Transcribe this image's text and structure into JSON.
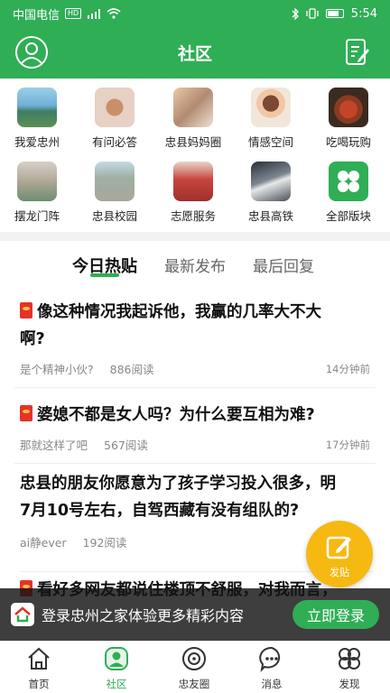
{
  "status_bar": {
    "carrier": "中国电信",
    "hd": "HD",
    "signal": "4G",
    "time": "5:54"
  },
  "header": {
    "title": "社区",
    "left_icon": "avatar-icon",
    "right_icon": "edit-note-icon"
  },
  "boards": [
    {
      "label": "我爱忠州",
      "thumb": "lake"
    },
    {
      "label": "有问必答",
      "thumb": "hands"
    },
    {
      "label": "忠县妈妈圈",
      "thumb": "moms"
    },
    {
      "label": "情感空间",
      "thumb": "girl"
    },
    {
      "label": "吃喝玩购",
      "thumb": "food"
    },
    {
      "label": "摆龙门阵",
      "thumb": "gate"
    },
    {
      "label": "忠县校园",
      "thumb": "school"
    },
    {
      "label": "志愿服务",
      "thumb": "volunteer"
    },
    {
      "label": "忠县高铁",
      "thumb": "train"
    },
    {
      "label": "全部版块",
      "thumb": "all"
    }
  ],
  "tabs": [
    {
      "label": "今日热贴",
      "active": true
    },
    {
      "label": "最新发布",
      "active": false
    },
    {
      "label": "最后回复",
      "active": false
    }
  ],
  "posts": [
    {
      "title_line1": "像这种情况我起诉他，我赢的几率大不大",
      "title_line2": "啊?",
      "author": "是个精神小伙?",
      "reads": "886阅读",
      "time": "14分钟前"
    },
    {
      "title_line1": "婆媳不都是女人吗？为什么要互相为难?",
      "title_line2": "",
      "author": "那就这样了吧",
      "reads": "567阅读",
      "time": "17分钟前"
    },
    {
      "title_line1": "忠县的朋友你愿意为了孩子学习投入很多，明",
      "title_line2": "7月10号左右，自驾西藏有没有组队的?",
      "author": "ai静ever",
      "reads": "192阅读",
      "time": ""
    },
    {
      "title_line1": "看好多网友都说住楼顶不舒服，对我而言，",
      "title_line2": "",
      "author": "",
      "reads": "",
      "time": ""
    }
  ],
  "fab": {
    "label": "发贴",
    "icon": "edit-icon"
  },
  "login_banner": {
    "text": "登录忠州之家体验更多精彩内容",
    "button": "立即登录"
  },
  "bottom_nav": [
    {
      "label": "首页",
      "icon": "home-icon",
      "active": false
    },
    {
      "label": "社区",
      "icon": "community-icon",
      "active": true
    },
    {
      "label": "忠友圈",
      "icon": "circle-icon",
      "active": false
    },
    {
      "label": "消息",
      "icon": "message-icon",
      "active": false
    },
    {
      "label": "发现",
      "icon": "discover-icon",
      "active": false
    }
  ],
  "colors": {
    "primary": "#2fae55",
    "fab": "#f5b912",
    "redbag": "#e5332a"
  }
}
